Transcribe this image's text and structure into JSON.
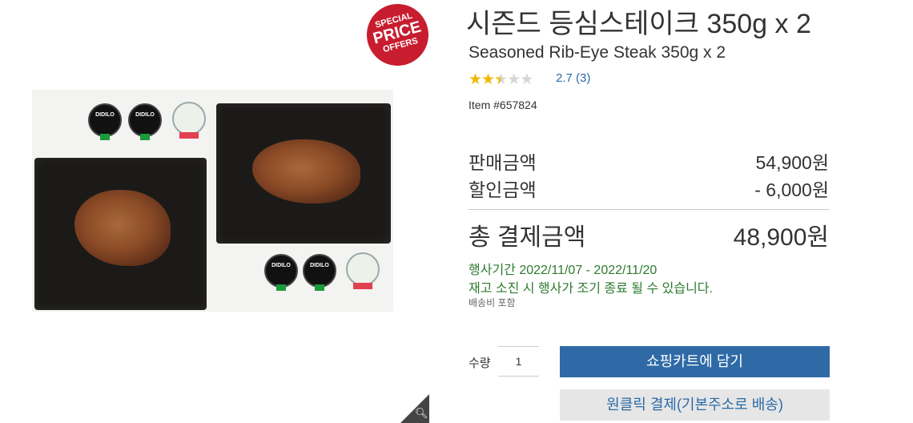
{
  "badge": {
    "line1": "SPECIAL",
    "line2": "PRICE",
    "line3": "OFFERS"
  },
  "product": {
    "title_ko": "시즌드 등심스테이크 350g x 2",
    "title_en": "Seasoned Rib-Eye Steak 350g x 2",
    "rating_value": "2.7",
    "rating_count": "(3)",
    "rating_stars": 2.5,
    "item_number": "Item #657824"
  },
  "image": {
    "sauce_label": "DIDILO"
  },
  "pricing": {
    "sale_label": "판매금액",
    "sale_value": "54,900원",
    "discount_label": "할인금액",
    "discount_value": "- 6,000원",
    "total_label": "총 결제금액",
    "total_value": "48,900원"
  },
  "promo": {
    "period": "행사기간 2022/11/07 - 2022/11/20",
    "note": "재고 소진 시 행사가 조기 종료 될 수 있습니다.",
    "shipping": "배송비 포함"
  },
  "purchase": {
    "qty_label": "수량",
    "qty_value": "1",
    "add_to_cart": "쇼핑카트에 담기",
    "one_click": "원클릭 결제(기본주소로 배송)"
  },
  "colors": {
    "accent": "#2f6aa7",
    "promo": "#2d7a2f",
    "badge": "#c81d2f",
    "star": "#f1b800"
  }
}
